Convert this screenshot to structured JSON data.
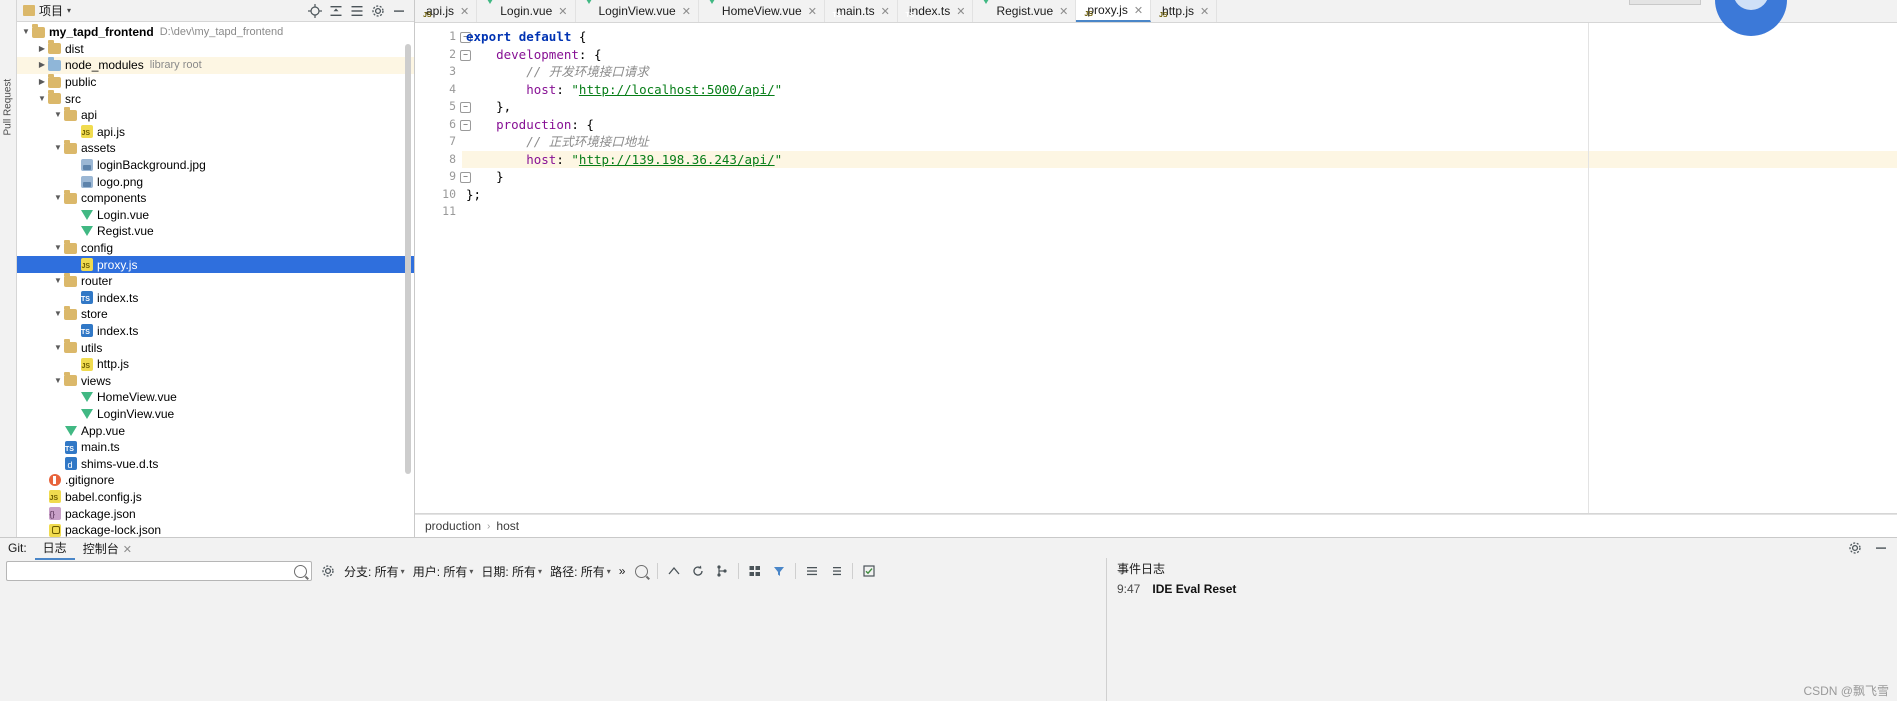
{
  "project_panel": {
    "title": "项目",
    "root": {
      "label": "my_tapd_frontend",
      "path": "D:\\dev\\my_tapd_frontend"
    },
    "tools": [
      "collapse-all-icon",
      "scroll-from-source-icon",
      "expand-icon",
      "settings-icon",
      "hide-icon"
    ],
    "tree": [
      {
        "indent": 1,
        "arrow": "▶",
        "icon": "folder",
        "label": "dist",
        "sub": "",
        "state": "normal"
      },
      {
        "indent": 1,
        "arrow": "▶",
        "icon": "folder-blue",
        "label": "node_modules",
        "sub": "library root",
        "state": "highlight"
      },
      {
        "indent": 1,
        "arrow": "▶",
        "icon": "folder",
        "label": "public",
        "sub": "",
        "state": "normal"
      },
      {
        "indent": 1,
        "arrow": "▼",
        "icon": "folder",
        "label": "src",
        "sub": "",
        "state": "normal"
      },
      {
        "indent": 2,
        "arrow": "▼",
        "icon": "folder",
        "label": "api",
        "sub": "",
        "state": "normal"
      },
      {
        "indent": 3,
        "arrow": "",
        "icon": "js",
        "label": "api.js",
        "sub": "",
        "state": "normal"
      },
      {
        "indent": 2,
        "arrow": "▼",
        "icon": "folder",
        "label": "assets",
        "sub": "",
        "state": "normal"
      },
      {
        "indent": 3,
        "arrow": "",
        "icon": "img",
        "label": "loginBackground.jpg",
        "sub": "",
        "state": "normal"
      },
      {
        "indent": 3,
        "arrow": "",
        "icon": "img",
        "label": "logo.png",
        "sub": "",
        "state": "normal"
      },
      {
        "indent": 2,
        "arrow": "▼",
        "icon": "folder",
        "label": "components",
        "sub": "",
        "state": "normal"
      },
      {
        "indent": 3,
        "arrow": "",
        "icon": "vue",
        "label": "Login.vue",
        "sub": "",
        "state": "normal"
      },
      {
        "indent": 3,
        "arrow": "",
        "icon": "vue",
        "label": "Regist.vue",
        "sub": "",
        "state": "normal"
      },
      {
        "indent": 2,
        "arrow": "▼",
        "icon": "folder",
        "label": "config",
        "sub": "",
        "state": "normal"
      },
      {
        "indent": 3,
        "arrow": "",
        "icon": "js",
        "label": "proxy.js",
        "sub": "",
        "state": "selected"
      },
      {
        "indent": 2,
        "arrow": "▼",
        "icon": "folder",
        "label": "router",
        "sub": "",
        "state": "normal"
      },
      {
        "indent": 3,
        "arrow": "",
        "icon": "ts",
        "label": "index.ts",
        "sub": "",
        "state": "normal"
      },
      {
        "indent": 2,
        "arrow": "▼",
        "icon": "folder",
        "label": "store",
        "sub": "",
        "state": "normal"
      },
      {
        "indent": 3,
        "arrow": "",
        "icon": "ts",
        "label": "index.ts",
        "sub": "",
        "state": "normal"
      },
      {
        "indent": 2,
        "arrow": "▼",
        "icon": "folder",
        "label": "utils",
        "sub": "",
        "state": "normal"
      },
      {
        "indent": 3,
        "arrow": "",
        "icon": "js",
        "label": "http.js",
        "sub": "",
        "state": "normal"
      },
      {
        "indent": 2,
        "arrow": "▼",
        "icon": "folder",
        "label": "views",
        "sub": "",
        "state": "normal"
      },
      {
        "indent": 3,
        "arrow": "",
        "icon": "vue",
        "label": "HomeView.vue",
        "sub": "",
        "state": "normal"
      },
      {
        "indent": 3,
        "arrow": "",
        "icon": "vue",
        "label": "LoginView.vue",
        "sub": "",
        "state": "normal"
      },
      {
        "indent": 2,
        "arrow": "",
        "icon": "vue",
        "label": "App.vue",
        "sub": "",
        "state": "normal"
      },
      {
        "indent": 2,
        "arrow": "",
        "icon": "ts",
        "label": "main.ts",
        "sub": "",
        "state": "normal"
      },
      {
        "indent": 2,
        "arrow": "",
        "icon": "dts",
        "label": "shims-vue.d.ts",
        "sub": "",
        "state": "normal"
      },
      {
        "indent": 1,
        "arrow": "",
        "icon": "git",
        "label": ".gitignore",
        "sub": "",
        "state": "normal"
      },
      {
        "indent": 1,
        "arrow": "",
        "icon": "js",
        "label": "babel.config.js",
        "sub": "",
        "state": "normal"
      },
      {
        "indent": 1,
        "arrow": "",
        "icon": "json",
        "label": "package.json",
        "sub": "",
        "state": "normal"
      },
      {
        "indent": 1,
        "arrow": "",
        "icon": "lock",
        "label": "package-lock.json",
        "sub": "",
        "state": "normal"
      }
    ]
  },
  "left_strip": {
    "label": "Pull Request"
  },
  "editor": {
    "tabs": [
      {
        "label": "api.js",
        "icon": "js",
        "active": false
      },
      {
        "label": "Login.vue",
        "icon": "vue",
        "active": false
      },
      {
        "label": "LoginView.vue",
        "icon": "vue",
        "active": false
      },
      {
        "label": "HomeView.vue",
        "icon": "vue",
        "active": false
      },
      {
        "label": "main.ts",
        "icon": "ts",
        "active": false
      },
      {
        "label": "index.ts",
        "icon": "ts",
        "active": false
      },
      {
        "label": "Regist.vue",
        "icon": "vue",
        "active": false
      },
      {
        "label": "proxy.js",
        "icon": "js",
        "active": true
      },
      {
        "label": "http.js",
        "icon": "js",
        "active": false
      }
    ],
    "gutter": [
      "1",
      "2",
      "3",
      "4",
      "5",
      "6",
      "7",
      "8",
      "9",
      "10",
      "11"
    ],
    "lines": [
      {
        "n": 1,
        "highlight": false,
        "tokens": [
          {
            "t": "export ",
            "c": "kw"
          },
          {
            "t": "default",
            "c": "kw"
          },
          {
            "t": " {",
            "c": "pl"
          }
        ]
      },
      {
        "n": 2,
        "highlight": false,
        "tokens": [
          {
            "t": "    ",
            "c": "pl"
          },
          {
            "t": "development",
            "c": "prop"
          },
          {
            "t": ": {",
            "c": "pl"
          }
        ]
      },
      {
        "n": 3,
        "highlight": false,
        "tokens": [
          {
            "t": "        ",
            "c": "pl"
          },
          {
            "t": "// 开发环境接口请求",
            "c": "cmt"
          }
        ]
      },
      {
        "n": 4,
        "highlight": false,
        "tokens": [
          {
            "t": "        ",
            "c": "pl"
          },
          {
            "t": "host",
            "c": "prop"
          },
          {
            "t": ": ",
            "c": "pl"
          },
          {
            "t": "\"",
            "c": "str"
          },
          {
            "t": "http://localhost:5000/api/",
            "c": "link"
          },
          {
            "t": "\"",
            "c": "str"
          }
        ]
      },
      {
        "n": 5,
        "highlight": false,
        "tokens": [
          {
            "t": "    },",
            "c": "pl"
          }
        ]
      },
      {
        "n": 6,
        "highlight": false,
        "tokens": [
          {
            "t": "    ",
            "c": "pl"
          },
          {
            "t": "production",
            "c": "prop"
          },
          {
            "t": ": {",
            "c": "pl"
          }
        ]
      },
      {
        "n": 7,
        "highlight": false,
        "tokens": [
          {
            "t": "        ",
            "c": "pl"
          },
          {
            "t": "// 正式环境接口地址",
            "c": "cmt"
          }
        ]
      },
      {
        "n": 8,
        "highlight": true,
        "tokens": [
          {
            "t": "        ",
            "c": "pl"
          },
          {
            "t": "host",
            "c": "prop"
          },
          {
            "t": ": ",
            "c": "pl"
          },
          {
            "t": "\"",
            "c": "str"
          },
          {
            "t": "http://139.198.36.243/api/",
            "c": "link"
          },
          {
            "t": "\"",
            "c": "str"
          }
        ]
      },
      {
        "n": 9,
        "highlight": false,
        "tokens": [
          {
            "t": "    }",
            "c": "pl"
          }
        ]
      },
      {
        "n": 10,
        "highlight": false,
        "tokens": [
          {
            "t": "};",
            "c": "pl"
          }
        ]
      },
      {
        "n": 11,
        "highlight": false,
        "tokens": [
          {
            "t": "",
            "c": "pl"
          }
        ]
      }
    ],
    "breadcrumb": [
      "production",
      "host"
    ]
  },
  "bottom": {
    "git_label": "Git:",
    "tabs": [
      {
        "label": "日志",
        "active": true,
        "closable": false
      },
      {
        "label": "控制台",
        "active": false,
        "closable": true
      }
    ],
    "tools": [
      "settings-icon",
      "hide-icon"
    ],
    "filters": [
      {
        "label": "分支: 所有"
      },
      {
        "label": "用户: 所有"
      },
      {
        "label": "日期: 所有"
      },
      {
        "label": "路径: 所有"
      }
    ],
    "overflow": "»",
    "search_placeholder": "",
    "right_panel": {
      "title": "事件日志",
      "event": {
        "time": "9:47",
        "message": "IDE Eval Reset"
      }
    }
  },
  "watermark": "CSDN @飘飞雪"
}
